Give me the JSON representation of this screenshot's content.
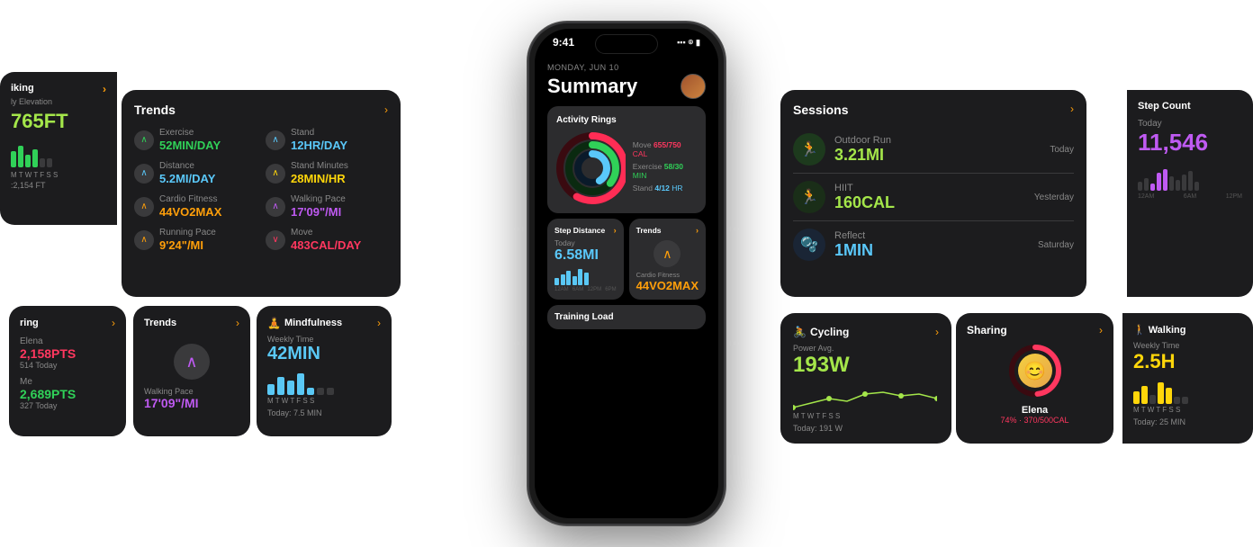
{
  "phone": {
    "time": "9:41",
    "date": "MONDAY, JUN 10",
    "title": "Summary",
    "activity_rings": {
      "title": "Activity Rings",
      "move_label": "Move",
      "move_val": "655/750",
      "move_unit": "CAL",
      "exercise_label": "Exercise",
      "exercise_val": "58/30",
      "exercise_unit": "MIN",
      "stand_label": "Stand",
      "stand_val": "4/12",
      "stand_unit": "HR"
    },
    "step_distance": {
      "title": "Step Distance",
      "today_label": "Today",
      "value": "6.58MI"
    },
    "trends_mini": {
      "title": "Trends",
      "label": "Cardio Fitness",
      "value": "44VO2MAX"
    },
    "training_load": {
      "title": "Training Load"
    }
  },
  "trends_big": {
    "title": "Trends",
    "items": [
      {
        "name": "Exercise",
        "value": "52MIN/DAY",
        "color": "green",
        "arrow": "up"
      },
      {
        "name": "Stand",
        "value": "12HR/DAY",
        "color": "cyan",
        "arrow": "up"
      },
      {
        "name": "Distance",
        "value": "5.2MI/DAY",
        "color": "cyan",
        "arrow": "up"
      },
      {
        "name": "Stand Minutes",
        "value": "28MIN/HR",
        "color": "yellow",
        "arrow": "up"
      },
      {
        "name": "Cardio Fitness",
        "value": "44VO2MAX",
        "color": "orange",
        "arrow": "up"
      },
      {
        "name": "Walking Pace",
        "value": "17'09\"/MI",
        "color": "purple",
        "arrow": "up"
      },
      {
        "name": "Running Pace",
        "value": "9'24\"/MI",
        "color": "orange",
        "arrow": "up"
      },
      {
        "name": "Move",
        "value": "483CAL/DAY",
        "color": "red",
        "arrow": "down"
      }
    ]
  },
  "hiking": {
    "title": "iking",
    "subtitle": "ly Elevation",
    "value": "765FT",
    "sub2": ";2,154 FT"
  },
  "sharing_left": {
    "title": "ring",
    "name1": "Elena",
    "val1": "2,158PTS",
    "sub1": "514 Today",
    "name2": "Me",
    "val2": "2,689PTS",
    "sub2": "327 Today"
  },
  "trends_small": {
    "title": "Trends",
    "label": "Walking Pace",
    "value": "17'09\"/MI"
  },
  "mindfulness": {
    "title": "Mindfulness",
    "weekly_label": "Weekly Time",
    "value": "42MIN",
    "today_label": "Today:",
    "today_val": "7.5 MIN"
  },
  "sessions": {
    "title": "Sessions",
    "items": [
      {
        "name": "Outdoor Run",
        "value": "3.21MI",
        "when": "Today",
        "color": "#1d3a1d",
        "icon": "🏃"
      },
      {
        "name": "HIIT",
        "value": "160CAL",
        "when": "Yesterday",
        "color": "#1d3020",
        "icon": "🏃"
      },
      {
        "name": "Reflect",
        "value": "1MIN",
        "when": "Saturday",
        "color": "#1a2a35",
        "icon": "🫧"
      }
    ]
  },
  "step_count": {
    "title": "Step Count",
    "today_label": "Today",
    "value": "11,546",
    "time_labels": [
      "12AM",
      "6AM",
      "12PM"
    ]
  },
  "cycling": {
    "title": "Cycling",
    "subtitle": "Power Avg.",
    "value": "193W",
    "today_label": "Today: 191 W"
  },
  "sharing_right": {
    "title": "Sharing",
    "name": "Elena",
    "value": "74% · 370/500CAL"
  },
  "walking": {
    "title": "Walking",
    "subtitle": "Weekly Time",
    "value": "2.5H",
    "today_label": "Today: 25 MIN"
  }
}
